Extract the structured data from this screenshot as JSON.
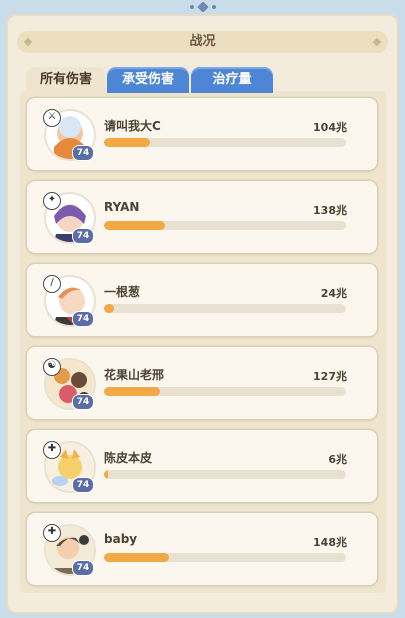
{
  "window": {
    "title": "战况"
  },
  "tabs": [
    {
      "label": "所有伤害",
      "active": true
    },
    {
      "label": "承受伤害",
      "active": false
    },
    {
      "label": "治疗量",
      "active": false
    }
  ],
  "colors": {
    "bar_fill": "#f0a944",
    "tab_inactive": "#4e86d6",
    "level_badge": "#5b6da6"
  },
  "players": [
    {
      "name": "请叫我大C",
      "value": "104兆",
      "level": "74",
      "progress_fraction": 0.19,
      "hero_icon": "hero-class-icon"
    },
    {
      "name": "RYAN",
      "value": "138兆",
      "level": "74",
      "progress_fraction": 0.25,
      "hero_icon": "hero-class-icon"
    },
    {
      "name": "一根葱",
      "value": "24兆",
      "level": "74",
      "progress_fraction": 0.04,
      "hero_icon": "hero-class-icon"
    },
    {
      "name": "花果山老邢",
      "value": "127兆",
      "level": "74",
      "progress_fraction": 0.23,
      "hero_icon": "hero-class-icon"
    },
    {
      "name": "陈皮本皮",
      "value": "6兆",
      "level": "74",
      "progress_fraction": 0.01,
      "hero_icon": "hero-class-icon"
    },
    {
      "name": "baby",
      "value": "148兆",
      "level": "74",
      "progress_fraction": 0.27,
      "hero_icon": "hero-class-icon"
    }
  ]
}
